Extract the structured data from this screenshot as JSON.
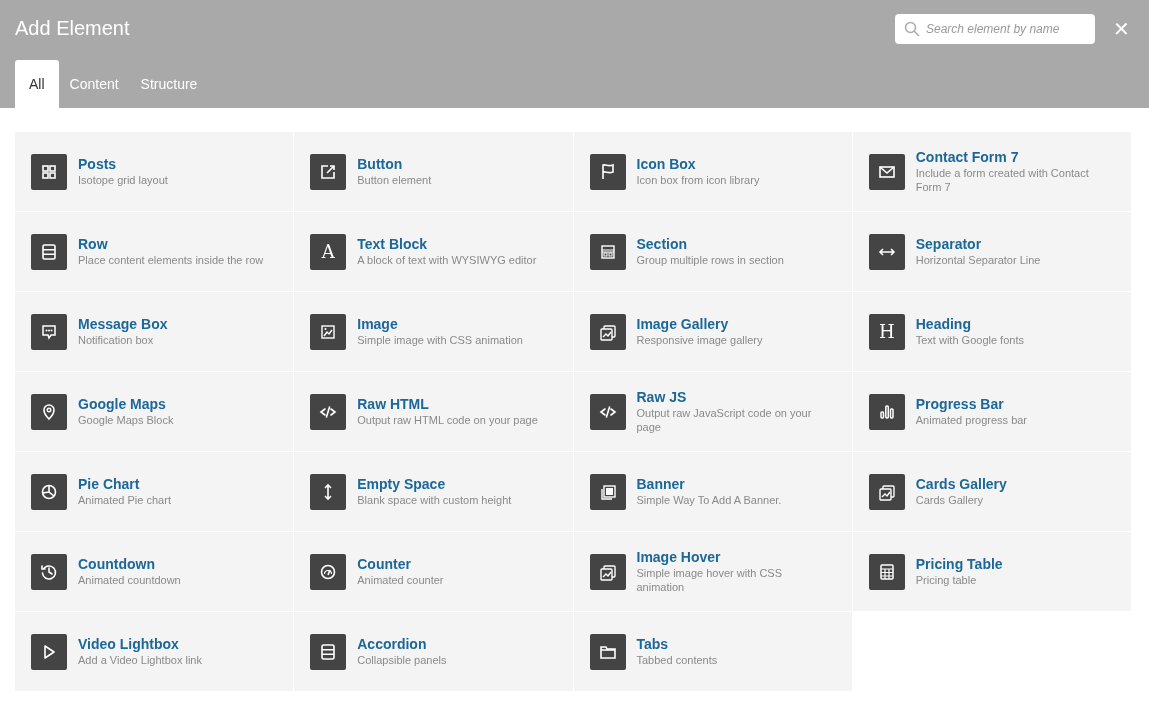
{
  "window": {
    "title": "Add Element",
    "close": "✕"
  },
  "search": {
    "placeholder": "Search element by name"
  },
  "tabs": [
    {
      "label": "All",
      "selected": true
    },
    {
      "label": "Content",
      "selected": false
    },
    {
      "label": "Structure",
      "selected": false
    }
  ],
  "elements": [
    {
      "title": "Posts",
      "description": "Isotope grid layout"
    },
    {
      "title": "Button",
      "description": "Button element"
    },
    {
      "title": "Icon Box",
      "description": "Icon box from icon library"
    },
    {
      "title": "Contact Form 7",
      "description": "Include a form created with Contact Form 7"
    },
    {
      "title": "Row",
      "description": "Place content elements inside the row"
    },
    {
      "title": "Text Block",
      "description": "A block of text with WYSIWYG editor",
      "glyph": "A"
    },
    {
      "title": "Section",
      "description": "Group multiple rows in section"
    },
    {
      "title": "Separator",
      "description": "Horizontal Separator Line"
    },
    {
      "title": "Message Box",
      "description": "Notification box"
    },
    {
      "title": "Image",
      "description": "Simple image with CSS animation"
    },
    {
      "title": "Image Gallery",
      "description": "Responsive image gallery"
    },
    {
      "title": "Heading",
      "description": "Text with Google fonts",
      "glyph": "H"
    },
    {
      "title": "Google Maps",
      "description": "Google Maps Block"
    },
    {
      "title": "Raw HTML",
      "description": "Output raw HTML code on your page"
    },
    {
      "title": "Raw JS",
      "description": "Output raw JavaScript code on your page"
    },
    {
      "title": "Progress Bar",
      "description": "Animated progress bar"
    },
    {
      "title": "Pie Chart",
      "description": "Animated Pie chart"
    },
    {
      "title": "Empty Space",
      "description": "Blank space with custom height"
    },
    {
      "title": "Banner",
      "description": "Simple Way To Add A Banner."
    },
    {
      "title": "Cards Gallery",
      "description": "Cards Gallery"
    },
    {
      "title": "Countdown",
      "description": "Animated countdown"
    },
    {
      "title": "Counter",
      "description": "Animated counter"
    },
    {
      "title": "Image Hover",
      "description": "Simple image hover with CSS animation"
    },
    {
      "title": "Pricing Table",
      "description": "Pricing table"
    },
    {
      "title": "Video Lightbox",
      "description": "Add a Video Lightbox link"
    },
    {
      "title": "Accordion",
      "description": "Collapsible panels"
    },
    {
      "title": "Tabs",
      "description": "Tabbed contents"
    }
  ]
}
